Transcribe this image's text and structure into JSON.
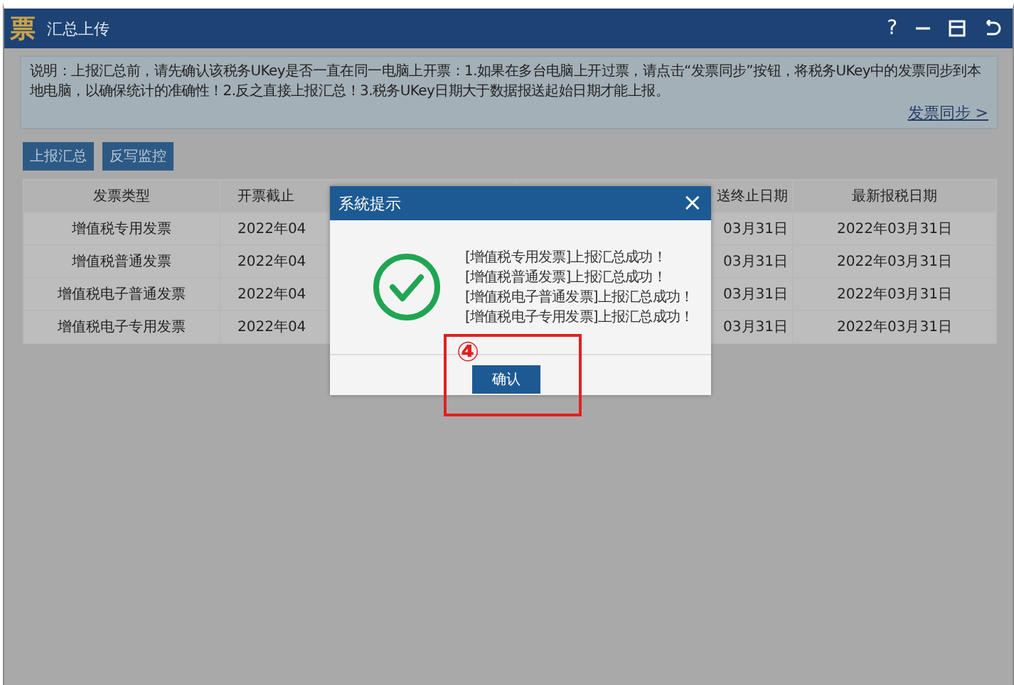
{
  "window": {
    "logo": "票",
    "title": "汇总上传",
    "help": "?"
  },
  "notice": {
    "text": "说明：上报汇总前，请先确认该税务UKey是否一直在同一电脑上开票：1.如果在多台电脑上开过票，请点击“发票同步”按钮，将税务UKey中的发票同步到本地电脑，以确保统计的准确性！2.反之直接上报汇总！3.税务UKey日期大于数据报送起始日期才能上报。",
    "link": "发票同步 >"
  },
  "toolbar": [
    "上报汇总",
    "反写监控"
  ],
  "table": {
    "columns": [
      "发票类型",
      "开票截止",
      "送终止日期",
      "最新报税日期"
    ],
    "rows": [
      [
        "增值税专用发票",
        "2022年04",
        "03月31日",
        "2022年03月31日"
      ],
      [
        "增值税普通发票",
        "2022年04",
        "03月31日",
        "2022年03月31日"
      ],
      [
        "增值税电子普通发票",
        "2022年04",
        "03月31日",
        "2022年03月31日"
      ],
      [
        "增值税电子专用发票",
        "2022年04",
        "03月31日",
        "2022年03月31日"
      ]
    ]
  },
  "dialog": {
    "title": "系統提示",
    "close": "×",
    "messages": [
      "[增值税专用发票]上报汇总成功！",
      "[增值税普通发票]上报汇总成功！",
      "[增值税电子普通发票]上报汇总成功！",
      "[增值税电子专用发票]上报汇总成功！"
    ],
    "button": "确认"
  },
  "callout": {
    "label": "④"
  }
}
